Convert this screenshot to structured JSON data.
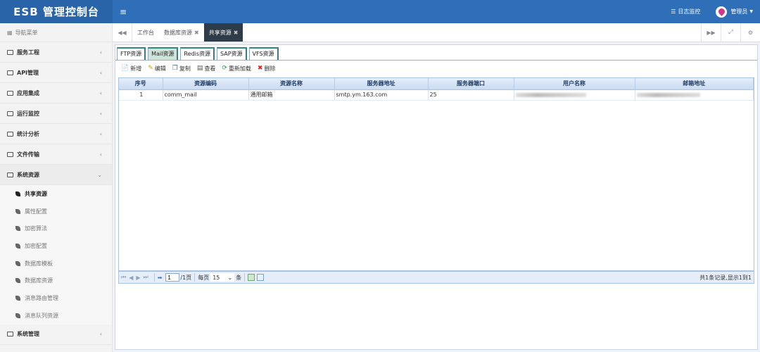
{
  "app": {
    "title": "ESB 管理控制台",
    "menu_icon": "≡"
  },
  "header": {
    "log_monitor": "日志监控",
    "user": "管理员"
  },
  "sidebar": {
    "title": "导航菜单",
    "items": [
      {
        "label": "服务工程"
      },
      {
        "label": "API管理"
      },
      {
        "label": "应用集成"
      },
      {
        "label": "运行监控"
      },
      {
        "label": "统计分析"
      },
      {
        "label": "文件传输"
      },
      {
        "label": "系统资源"
      }
    ],
    "submenu": [
      {
        "label": "共享资源"
      },
      {
        "label": "属性配置"
      },
      {
        "label": "加密算法"
      },
      {
        "label": "加密配置"
      },
      {
        "label": "数据库模板"
      },
      {
        "label": "数据库资源"
      },
      {
        "label": "消息路由管理"
      },
      {
        "label": "消息队列资源"
      }
    ],
    "last_item": {
      "label": "系统管理"
    }
  },
  "tabs": [
    {
      "label": "工作台"
    },
    {
      "label": "数据库资源"
    },
    {
      "label": "共享资源"
    }
  ],
  "subtabs": [
    {
      "label": "FTP资源"
    },
    {
      "label": "Mail资源"
    },
    {
      "label": "Redis资源"
    },
    {
      "label": "SAP资源"
    },
    {
      "label": "VFS资源"
    }
  ],
  "toolbar": {
    "add": "新增",
    "edit": "编辑",
    "copy": "复制",
    "view": "查看",
    "reload": "重新加载",
    "delete": "删除"
  },
  "table": {
    "columns": [
      "序号",
      "资源编码",
      "资源名称",
      "服务器地址",
      "服务器端口",
      "用户名称",
      "邮箱地址"
    ],
    "rows": [
      {
        "no": "1",
        "code": "comm_mail",
        "name": "通用邮箱",
        "host": "smtp.ym.163.com",
        "port": "25"
      }
    ]
  },
  "pager": {
    "page": "1",
    "total_pages": "/1页",
    "per_page_label": "每页",
    "per_page": "15",
    "unit": "条",
    "summary": "共1条记录,显示1到1"
  }
}
